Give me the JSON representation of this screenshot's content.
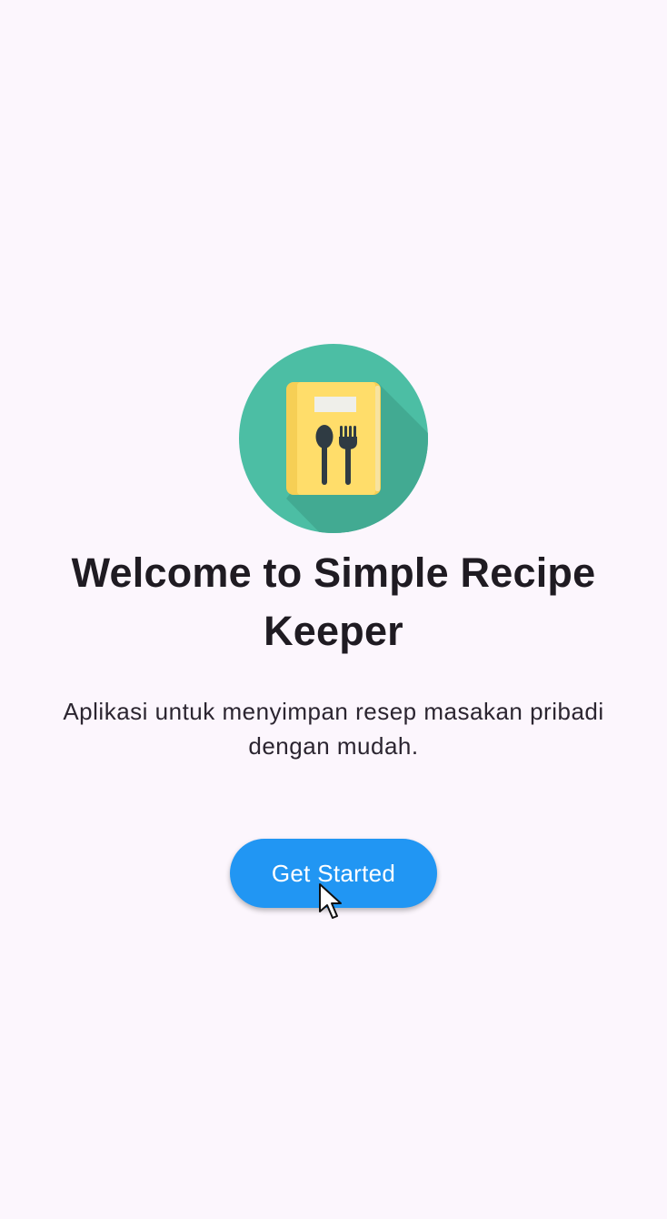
{
  "app": {
    "background": "#fcf6fd",
    "logo_icon": "recipe-book-icon",
    "title": "Welcome to Simple Recipe Keeper",
    "subtitle": "Aplikasi untuk menyimpan resep masakan pribadi dengan mudah.",
    "cta_label": "Get Started",
    "cta_color": "#2196f3",
    "cursor_icon": "pointer-cursor-icon"
  }
}
